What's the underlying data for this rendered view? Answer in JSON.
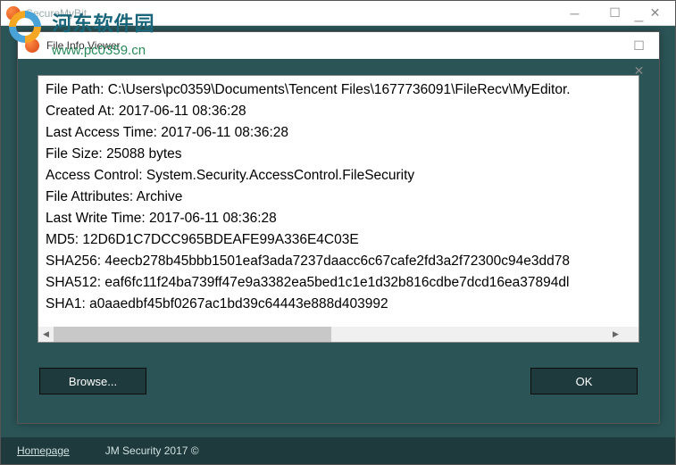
{
  "watermark": {
    "title": "河东软件园",
    "url": "www.pc0359.cn"
  },
  "outerWindow": {
    "title": "SecureMyBit"
  },
  "innerWindow": {
    "title": "File Info Viewer"
  },
  "fileInfo": {
    "filePathLabel": "File Path:",
    "filePath": "C:\\Users\\pc0359\\Documents\\Tencent Files\\1677736091\\FileRecv\\MyEditor.",
    "createdAtLabel": "Created At:",
    "createdAt": "2017-06-11 08:36:28",
    "lastAccessLabel": "Last Access Time:",
    "lastAccess": "2017-06-11 08:36:28",
    "fileSizeLabel": "File Size:",
    "fileSize": "25088 bytes",
    "accessControlLabel": "Access Control:",
    "accessControl": "System.Security.AccessControl.FileSecurity",
    "fileAttributesLabel": "File Attributes:",
    "fileAttributes": "Archive",
    "lastWriteLabel": "Last Write Time:",
    "lastWrite": "2017-06-11 08:36:28",
    "md5Label": "MD5:",
    "md5": "12D6D1C7DCC965BDEAFE99A336E4C03E",
    "sha256Label": "SHA256:",
    "sha256": "4eecb278b45bbb1501eaf3ada7237daacc6c67cafe2fd3a2f72300c94e3dd78",
    "sha512Label": "SHA512:",
    "sha512": "eaf6fc11f24ba739ff47e9a3382ea5bed1c1e1d32b816cdbe7dcd16ea37894dl",
    "sha1Label": "SHA1:",
    "sha1": "a0aaedbf45bf0267ac1bd39c64443e888d403992"
  },
  "buttons": {
    "browse": "Browse...",
    "ok": "OK"
  },
  "footer": {
    "homepage": "Homepage",
    "copyright": "JM Security 2017 ©"
  }
}
